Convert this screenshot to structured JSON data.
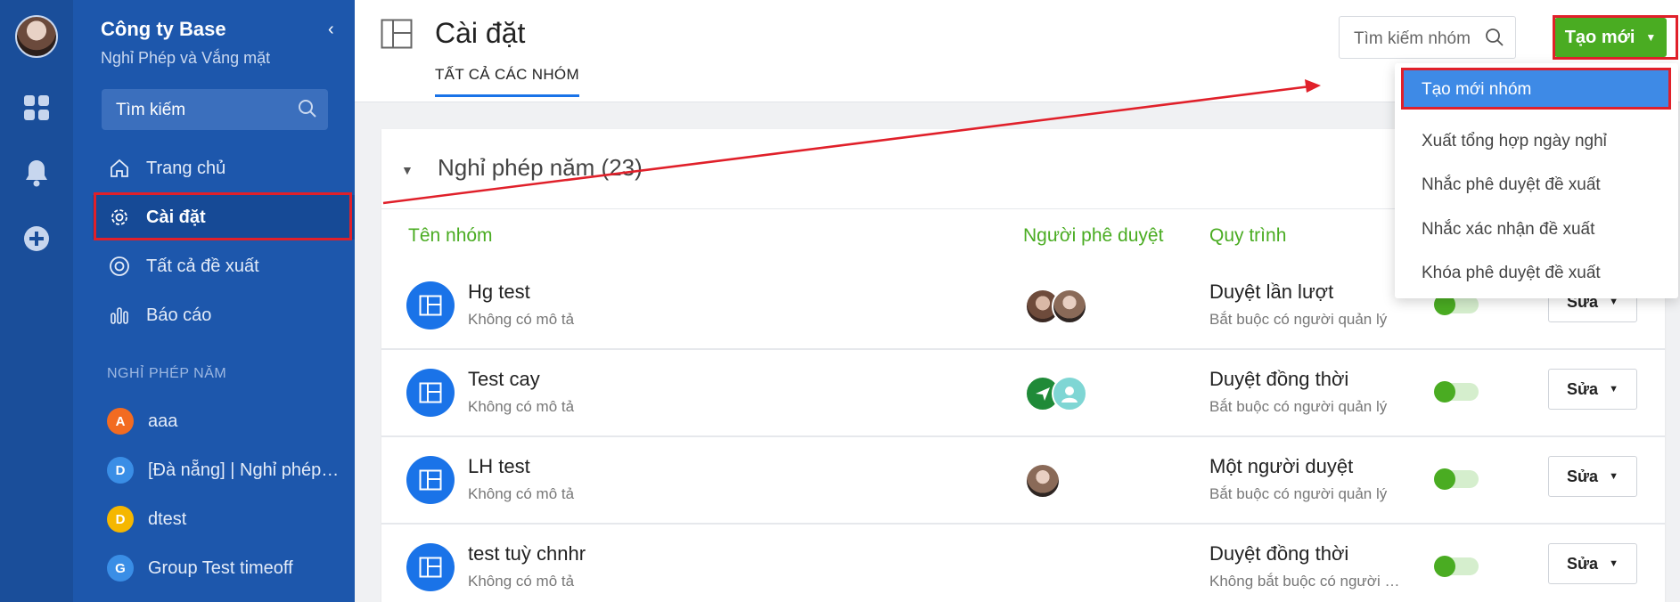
{
  "sidebar": {
    "company": "Công ty Base",
    "module": "Nghỉ Phép và Vắng mặt",
    "search_placeholder": "Tìm kiếm",
    "nav": [
      {
        "label": "Trang chủ",
        "icon": "home-icon"
      },
      {
        "label": "Cài đặt",
        "icon": "gear-icon"
      },
      {
        "label": "Tất cả đề xuất",
        "icon": "circle-icon"
      },
      {
        "label": "Báo cáo",
        "icon": "bar-chart-icon"
      }
    ],
    "section_label": "NGHỈ PHÉP NĂM",
    "groups": [
      {
        "initial": "A",
        "label": "aaa",
        "color": "#f26b21"
      },
      {
        "initial": "D",
        "label": "[Đà nẵng] | Nghỉ phép…",
        "color": "#3a8ee6"
      },
      {
        "initial": "D",
        "label": "dtest",
        "color": "#f5b700"
      },
      {
        "initial": "G",
        "label": "Group Test timeoff",
        "color": "#3a8ee6"
      }
    ]
  },
  "header": {
    "title": "Cài đặt",
    "tab": "TẤT CẢ CÁC NHÓM",
    "search_placeholder": "Tìm kiếm nhóm",
    "create_label": "Tạo mới"
  },
  "dropdown": {
    "items": [
      "Tạo mới nhóm",
      "Xuất tổng hợp ngày nghỉ",
      "Nhắc phê duyệt đề xuất",
      "Nhắc xác nhận đề xuất",
      "Khóa phê duyệt đề xuất"
    ]
  },
  "card": {
    "title": "Nghỉ phép năm (23)",
    "columns": {
      "name": "Tên nhóm",
      "approver": "Người phê duyệt",
      "process": "Quy trình"
    },
    "rows": [
      {
        "name": "Hg test",
        "desc": "Không có mô tả",
        "process": "Duyệt lần lượt",
        "process_desc": "Bắt buộc có người quản lý",
        "edit": "Sửa"
      },
      {
        "name": "Test cay",
        "desc": "Không có mô tả",
        "process": "Duyệt đồng thời",
        "process_desc": "Bắt buộc có người quản lý",
        "edit": "Sửa"
      },
      {
        "name": "LH test",
        "desc": "Không có mô tả",
        "process": "Một người duyệt",
        "process_desc": "Bắt buộc có người quản lý",
        "edit": "Sửa"
      },
      {
        "name": "test tuỳ chnhr",
        "desc": "Không có mô tả",
        "process": "Duyệt đồng thời",
        "process_desc": "Không bắt buộc có người …",
        "edit": "Sửa"
      }
    ]
  },
  "colors": {
    "rail": "#1a4e9a",
    "sidebar": "#1d57ac",
    "accent_green": "#4aac22",
    "accent_blue": "#1a73e8",
    "annotation_red": "#e0202a"
  }
}
